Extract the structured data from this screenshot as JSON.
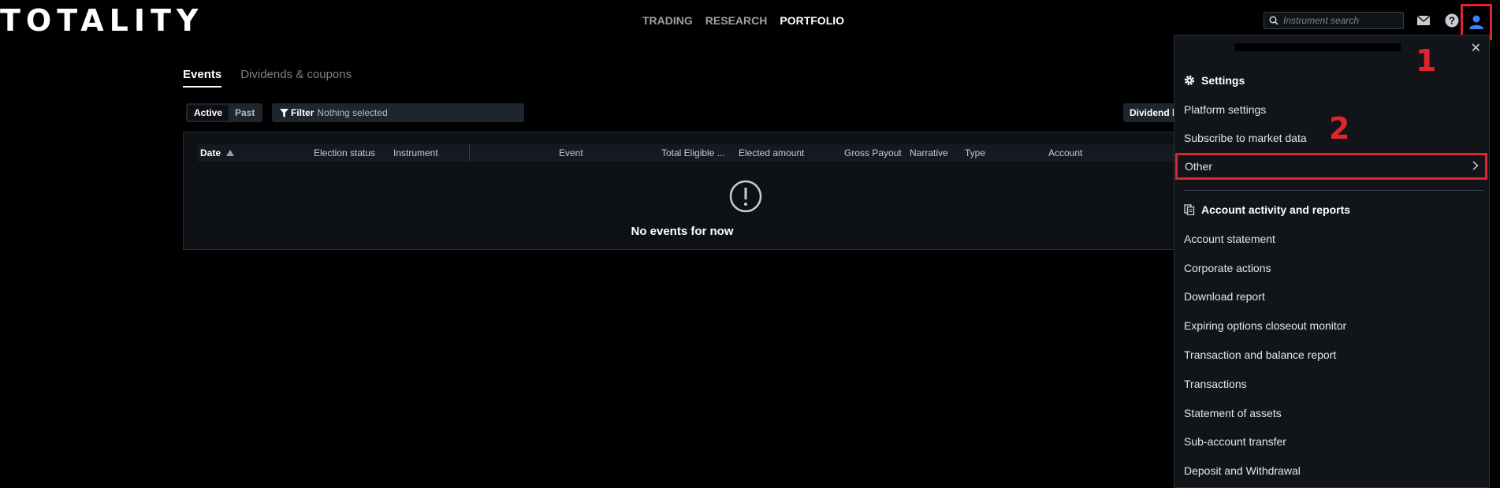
{
  "header": {
    "logo": "TOTALITY",
    "nav": [
      {
        "label": "TRADING",
        "active": false
      },
      {
        "label": "RESEARCH",
        "active": false
      },
      {
        "label": "PORTFOLIO",
        "active": true
      }
    ],
    "search_placeholder": "Instrument search",
    "icons": [
      "search-icon",
      "mail-icon",
      "help-icon",
      "user-icon"
    ]
  },
  "tabs": [
    {
      "label": "Events",
      "active": true
    },
    {
      "label": "Dividends & coupons",
      "active": false
    }
  ],
  "toggle": {
    "active": "Active",
    "past": "Past"
  },
  "filter": {
    "label": "Filter",
    "value": "Nothing selected"
  },
  "dividend_button": "Dividend l",
  "grid": {
    "columns": [
      "Date",
      "Election status",
      "Instrument",
      "Event",
      "Total Eligible ...",
      "Elected amount",
      "Gross Payout",
      "Narrative",
      "Type",
      "Account"
    ],
    "sort_column": "Date",
    "empty_message": "No events for now"
  },
  "menu": {
    "annotations": [
      "1",
      "2"
    ],
    "settings_title": "Settings",
    "settings_items": [
      "Platform settings",
      "Subscribe to market data"
    ],
    "other_label": "Other",
    "reports_title": "Account activity and reports",
    "report_items": [
      "Account statement",
      "Corporate actions",
      "Download report",
      "Expiring options closeout monitor",
      "Transaction and balance report",
      "Transactions",
      "Statement of assets",
      "Sub-account transfer",
      "Deposit and Withdrawal"
    ]
  },
  "colors": {
    "highlight": "#e0242f",
    "background": "#000000",
    "panel": "#11151a"
  }
}
